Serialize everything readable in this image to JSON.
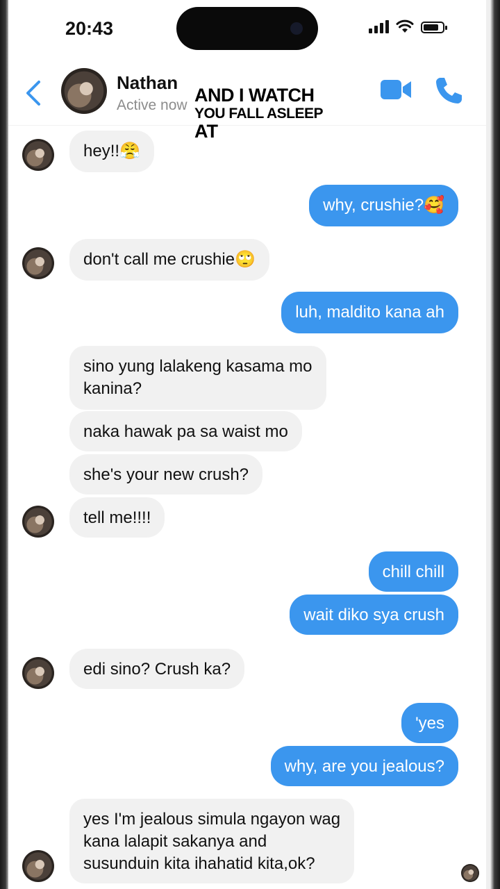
{
  "status_bar": {
    "time": "20:43"
  },
  "header": {
    "contact_name": "Nathan",
    "contact_status": "Active now",
    "overlay_caption": {
      "line1": "AND I WATCH",
      "line2": "YOU FALL ASLEEP",
      "line3": "AT"
    }
  },
  "icons": {
    "back": "chevron-left-icon",
    "video": "video-camera-icon",
    "call": "phone-icon"
  },
  "colors": {
    "accent": "#3b96ee",
    "incoming_bubble": "#f1f1f1",
    "outgoing_text": "#ffffff"
  },
  "messages": [
    {
      "from": "them",
      "text": "hey!!😤"
    },
    {
      "from": "me",
      "text": "why, crushie?🥰"
    },
    {
      "from": "them",
      "text": "don't call me crushie🙄"
    },
    {
      "from": "me",
      "text": "luh, maldito kana ah"
    },
    {
      "from": "them",
      "text": "sino yung lalakeng kasama mo\nkanina?"
    },
    {
      "from": "them",
      "text": "naka hawak pa sa waist mo"
    },
    {
      "from": "them",
      "text": "she's your new crush?"
    },
    {
      "from": "them",
      "text": "tell me!!!!"
    },
    {
      "from": "me",
      "text": "chill chill"
    },
    {
      "from": "me",
      "text": "wait diko sya crush"
    },
    {
      "from": "them",
      "text": "edi sino? Crush ka?"
    },
    {
      "from": "me",
      "text": "'yes"
    },
    {
      "from": "me",
      "text": "why, are you jealous?"
    },
    {
      "from": "them",
      "text": "yes I'm jealous simula ngayon wag\nkana lalapit sakanya and\nsusunduin kita ihahatid kita,ok?"
    }
  ]
}
